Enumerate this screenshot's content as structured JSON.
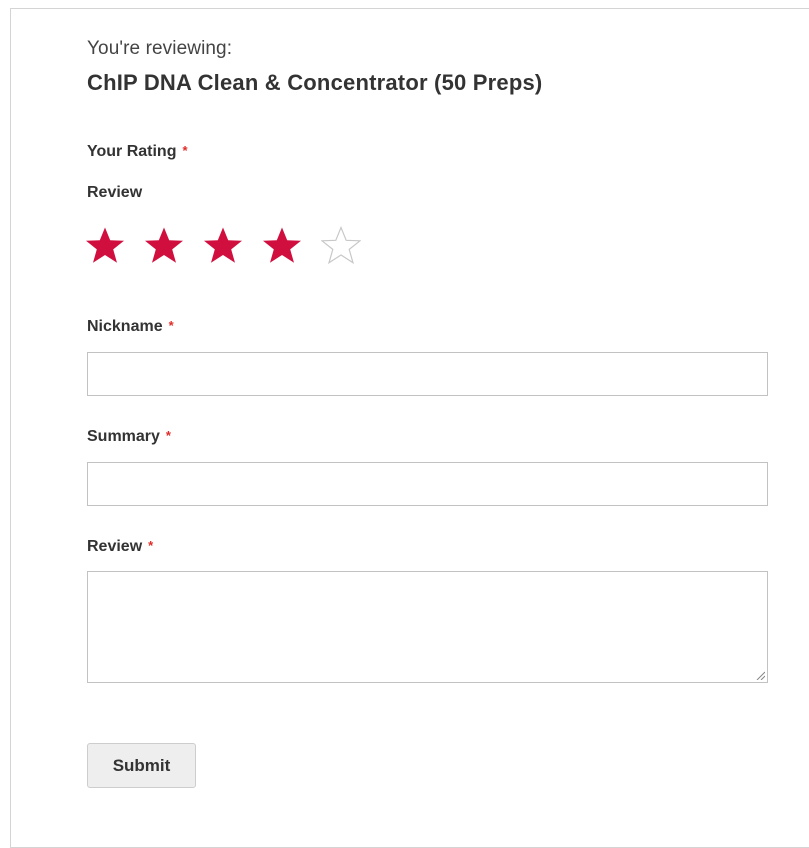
{
  "header": {
    "intro": "You're reviewing:",
    "product_name": "ChIP DNA Clean & Concentrator (50 Preps)"
  },
  "rating": {
    "label": "Your Rating",
    "required_mark": "*",
    "sublabel": "Review",
    "value": 4,
    "max": 5,
    "filled_color": "#d10f3e",
    "empty_color": "#c8c8c8",
    "icon": "star-icon"
  },
  "fields": {
    "nickname": {
      "label": "Nickname",
      "required_mark": "*",
      "value": "",
      "placeholder": ""
    },
    "summary": {
      "label": "Summary",
      "required_mark": "*",
      "value": "",
      "placeholder": ""
    },
    "review": {
      "label": "Review",
      "required_mark": "*",
      "value": "",
      "placeholder": ""
    }
  },
  "actions": {
    "submit_label": "Submit"
  },
  "colors": {
    "required": "#e02b27",
    "border": "#c2c2c2",
    "button_bg": "#eeeeee"
  }
}
